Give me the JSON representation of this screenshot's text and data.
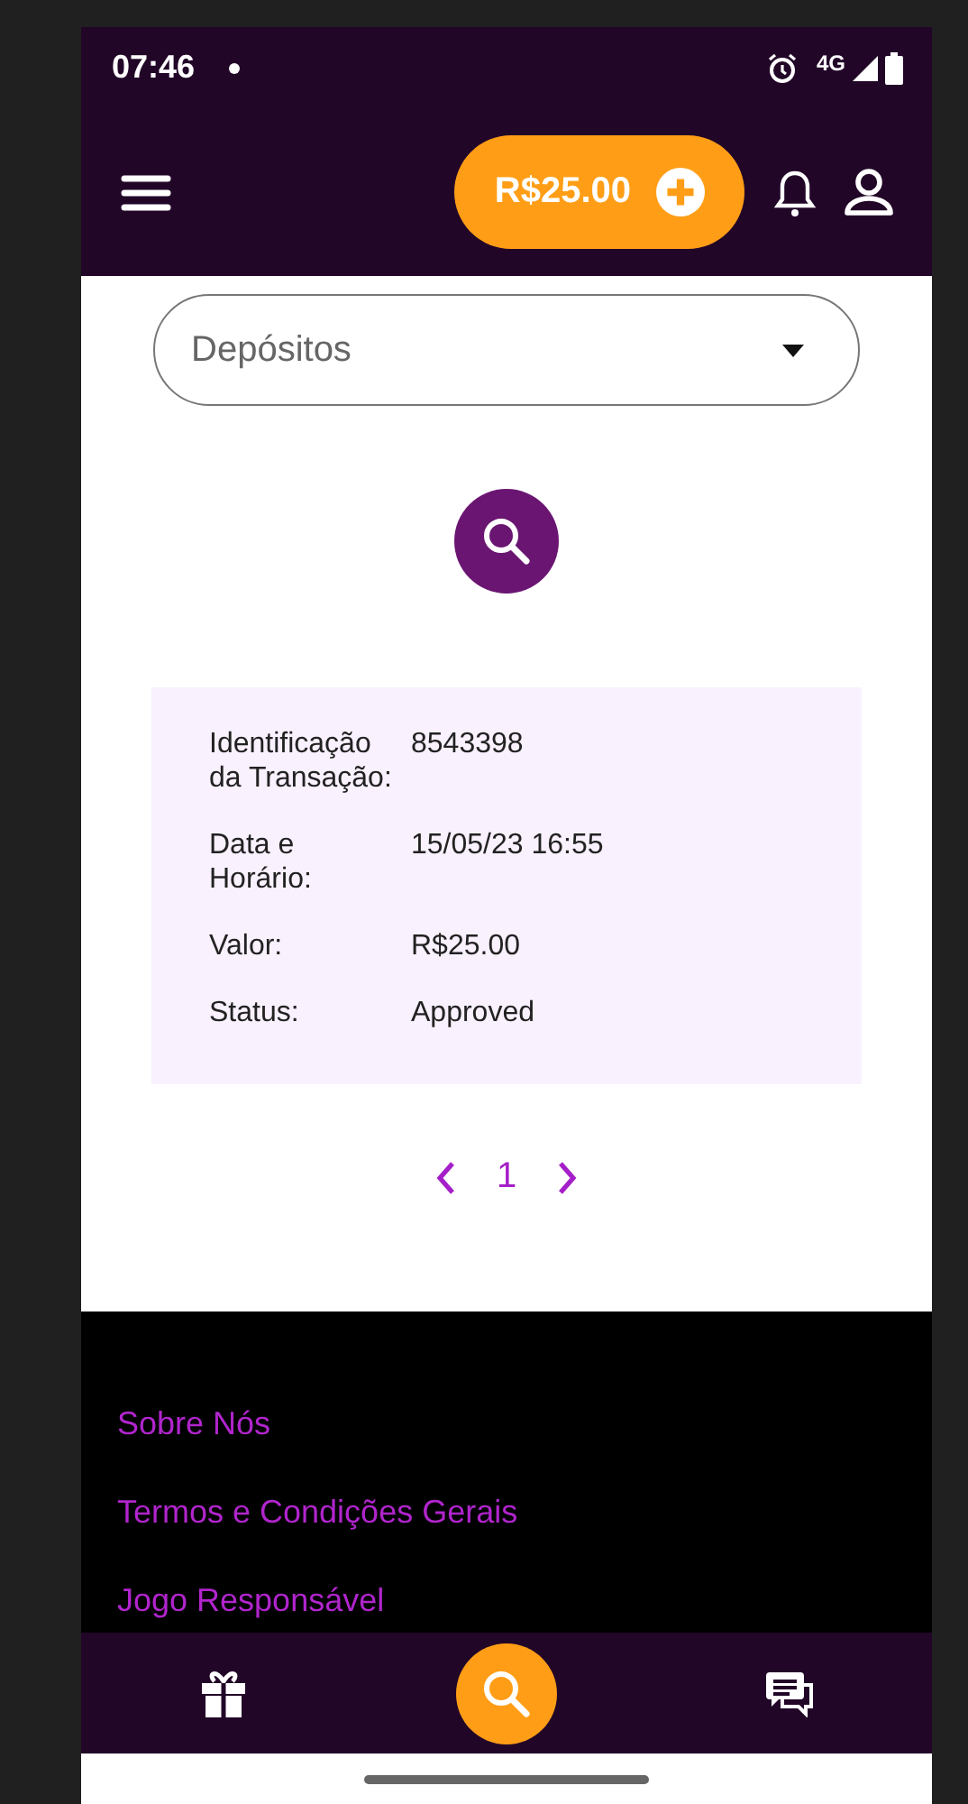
{
  "status_bar": {
    "time": "07:46",
    "network": "4G"
  },
  "header": {
    "balance": "R$25.00"
  },
  "filter": {
    "value": "Depósitos"
  },
  "transaction": {
    "rows": [
      {
        "label": "Identificação da Transação:",
        "value": "8543398"
      },
      {
        "label": "Data e Horário:",
        "value": "15/05/23 16:55"
      },
      {
        "label": "Valor:",
        "value": "R$25.00"
      },
      {
        "label": "Status:",
        "value": "Approved"
      }
    ]
  },
  "pagination": {
    "page": "1"
  },
  "footer": {
    "links": [
      "Sobre Nós",
      "Termos e Condições Gerais",
      "Jogo Responsável"
    ]
  },
  "bottom_nav": [
    {
      "kind": "gift",
      "selected": false
    },
    {
      "kind": "search",
      "selected": true
    },
    {
      "kind": "chat",
      "selected": false
    }
  ]
}
